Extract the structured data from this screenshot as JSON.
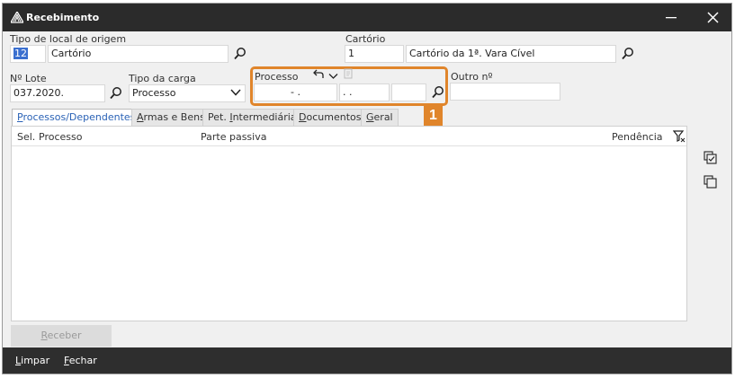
{
  "window": {
    "title": "Recebimento"
  },
  "origem": {
    "label": "Tipo de local de origem",
    "code": "12",
    "name": "Cartório"
  },
  "cartorio": {
    "label": "Cartório",
    "code": "1",
    "name": "Cartório da 1ª. Vara Cível"
  },
  "lote": {
    "label": "Nº Lote",
    "value": "037.2020."
  },
  "carga": {
    "label": "Tipo da carga",
    "value": "Processo"
  },
  "processo": {
    "label": "Processo",
    "part1": "-  .",
    "part2": ".  .",
    "part3": ""
  },
  "outro": {
    "label": "Outro nº",
    "value": ""
  },
  "badge": "1",
  "tabs": [
    {
      "prefix": "",
      "key": "P",
      "rest": "rocessos/Dependentes"
    },
    {
      "prefix": "",
      "key": "A",
      "rest": "rmas e Bens"
    },
    {
      "prefix": "Pet. ",
      "key": "I",
      "rest": "ntermediária"
    },
    {
      "prefix": "",
      "key": "D",
      "rest": "ocumentos"
    },
    {
      "prefix": "",
      "key": "G",
      "rest": "eral"
    }
  ],
  "grid": {
    "col_sel": "Sel.",
    "col_processo": "Processo",
    "col_parte": "Parte passiva",
    "col_pendencia": "Pendência"
  },
  "actions": {
    "receber": {
      "key": "R",
      "rest": "eceber"
    },
    "limpar": {
      "key": "L",
      "rest": "impar"
    },
    "fechar": {
      "key": "F",
      "rest": "echar"
    }
  }
}
